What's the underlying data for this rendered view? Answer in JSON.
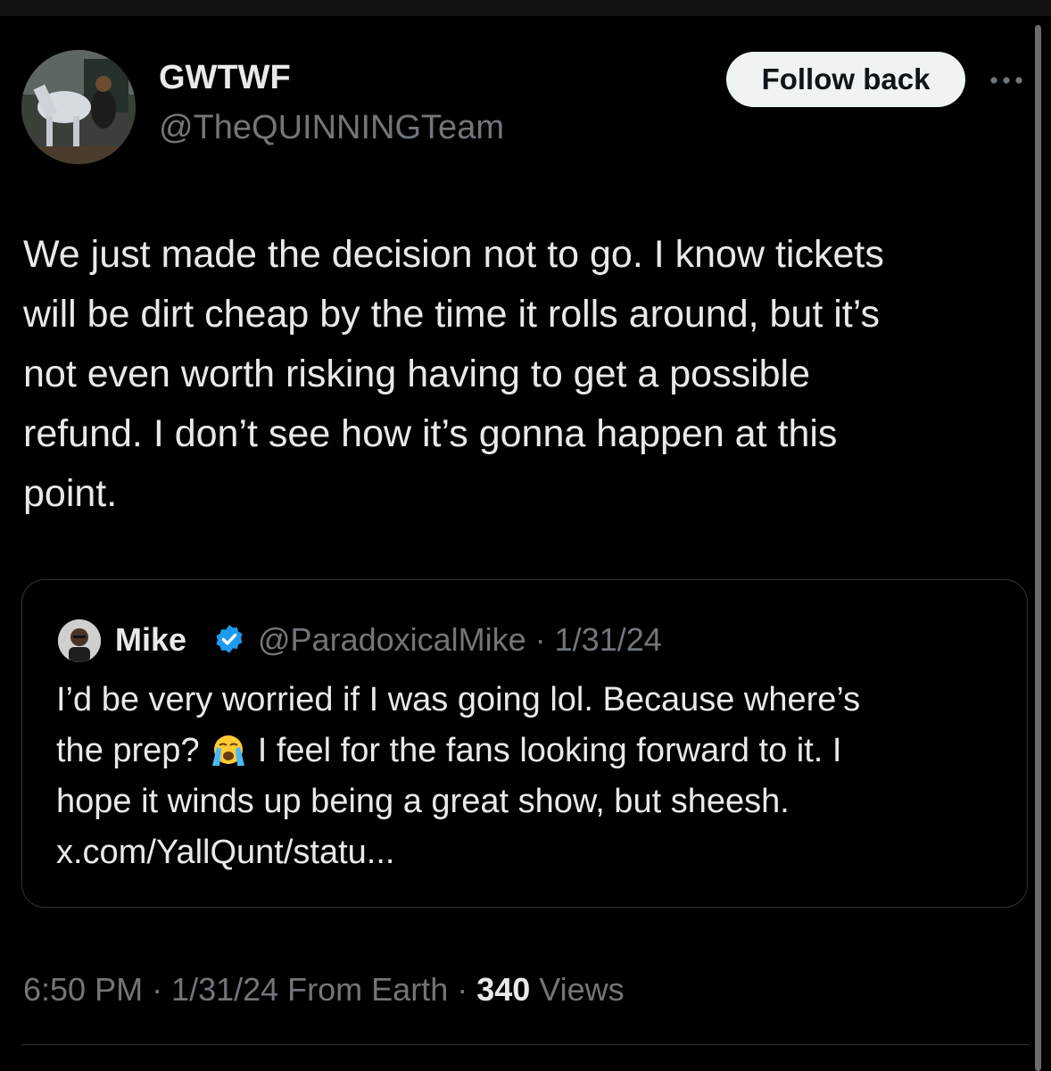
{
  "tweet": {
    "display_name": "GWTWF",
    "handle": "@TheQUINNINGTeam",
    "follow_label": "Follow back",
    "more_icon": "more-horizontal-icon",
    "text_lines": [
      "We just made the decision not to go. I know tickets",
      "will be dirt cheap by the time it rolls around, but it’s",
      "not even worth risking having to get a possible",
      "refund. I don’t see how it’s gonna happen at this",
      "point."
    ]
  },
  "quote": {
    "name": "Mike",
    "verified_icon": "verified-badge-icon",
    "handle_date": "@ParadoxicalMike · 1/31/24",
    "line1": "I’d be very worried if I was going lol. Because where’s",
    "line2_before": "the prep?",
    "emoji": "loudly-crying-face-emoji",
    "line2_after": "I feel for the fans looking forward to it. I",
    "line3": "hope it winds up being a great show, but sheesh.",
    "link": "x.com/YallQunt/statu..."
  },
  "meta": {
    "time_date": "6:50 PM · 1/31/24 From Earth · ",
    "views_count": "340",
    "views_label": "Views"
  },
  "colors": {
    "background": "#000000",
    "text_primary": "#e7e9ea",
    "text_secondary": "#71767b",
    "verified": "#1d9bf0",
    "border": "#2f3336"
  }
}
